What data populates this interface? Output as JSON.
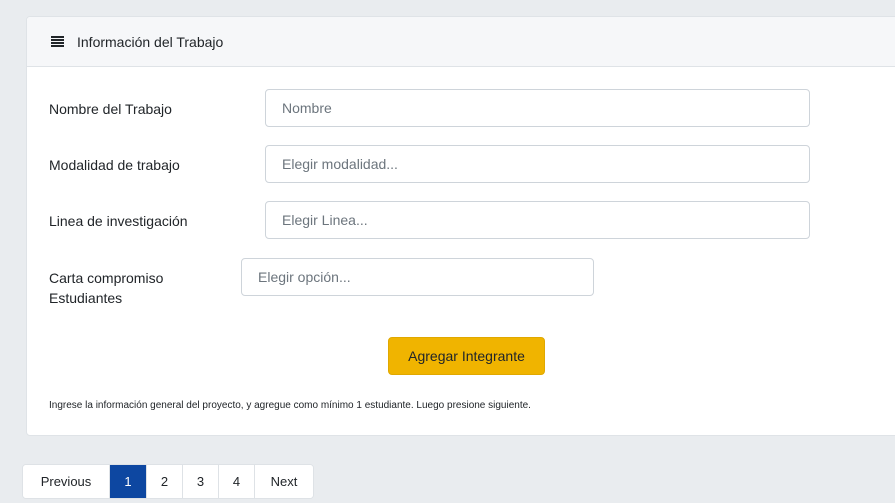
{
  "card": {
    "title": "Información del Trabajo",
    "header_icon": "list-icon"
  },
  "form": {
    "nombre": {
      "label": "Nombre del Trabajo",
      "placeholder": "Nombre"
    },
    "modalidad": {
      "label": "Modalidad de trabajo",
      "placeholder": "Elegir modalidad..."
    },
    "linea": {
      "label": "Linea de investigación",
      "placeholder": "Elegir Linea..."
    },
    "carta": {
      "label_line1": "Carta compromiso",
      "label_line2": "Estudiantes",
      "placeholder": "Elegir opción..."
    }
  },
  "actions": {
    "add_member_label": "Agregar Integrante",
    "accent_color": "#f0b400"
  },
  "help_text": "Ingrese la información general del proyecto, y agregue como mínimo 1 estudiante. Luego presione siguiente.",
  "pagination": {
    "previous": "Previous",
    "pages": [
      "1",
      "2",
      "3",
      "4"
    ],
    "active_page": "1",
    "next": "Next",
    "active_color": "#0d47a1"
  }
}
